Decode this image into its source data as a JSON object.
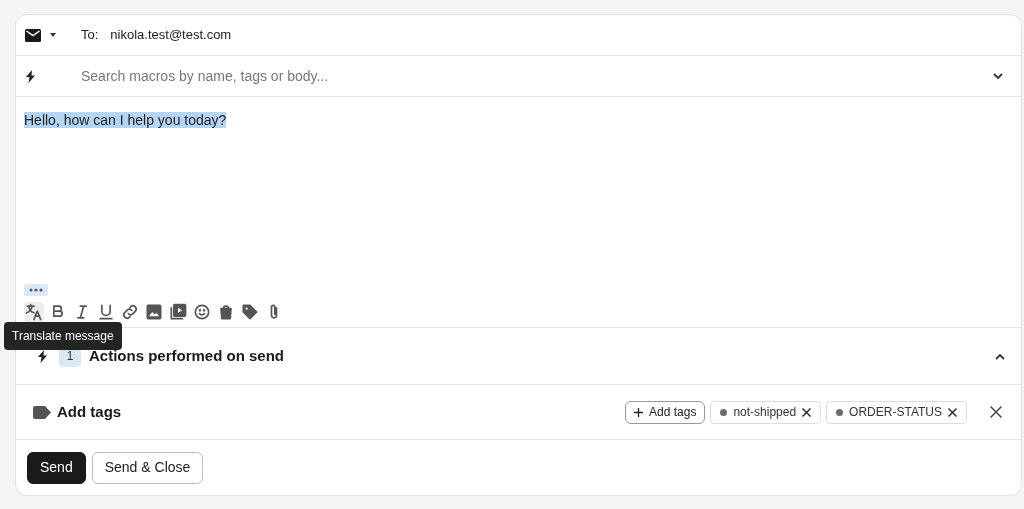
{
  "recipient": {
    "label": "To:",
    "value": "nikola.test@test.com"
  },
  "macro_search": {
    "placeholder": "Search macros by name, tags or body..."
  },
  "editor": {
    "text": "Hello, how can I help you today?",
    "selected": true
  },
  "tooltip": {
    "text": "Translate message"
  },
  "actions": {
    "count": "1",
    "title": "Actions performed on send",
    "expanded": true
  },
  "tags_section": {
    "title": "Add tags",
    "add_button": "Add tags",
    "tags": [
      {
        "label": "not-shipped",
        "color": "#6b6b6b"
      },
      {
        "label": "ORDER-STATUS",
        "color": "#6b6b6b"
      }
    ]
  },
  "buttons": [
    {
      "label": "Send",
      "kind": "primary"
    },
    {
      "label": "Send & Close",
      "kind": "secondary"
    }
  ]
}
